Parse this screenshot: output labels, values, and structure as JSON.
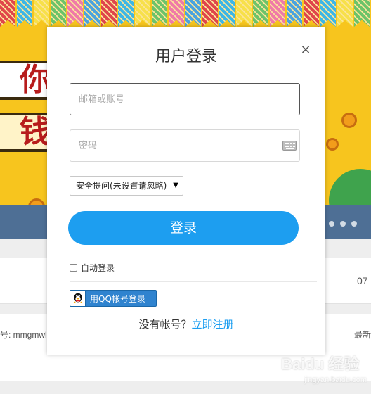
{
  "dialog": {
    "title": "用户登录",
    "close_label": "×",
    "email_placeholder": "邮箱或账号",
    "password_placeholder": "密码",
    "security_question": "安全提问(未设置请忽略)",
    "login_label": "登录",
    "auto_login_label": "自动登录",
    "qq_login_label": "用QQ帐号登录",
    "no_account_text": "没有帐号？",
    "register_label": "立即注册"
  },
  "background": {
    "banner_text_1": "你在",
    "banner_text_2": "钱",
    "row1_right": "07",
    "row2_left": "号: mmgmwl",
    "row2_right": "最新"
  },
  "watermark": {
    "text": "Baidu 经验",
    "sub": "jingyan.baidu.com"
  },
  "colors": {
    "accent": "#1d9ef0",
    "banner": "#f7c51e",
    "qq_button": "#2f83cf"
  },
  "icons": [
    "close-icon",
    "keyboard-icon",
    "caret-down-icon",
    "qq-penguin-icon"
  ]
}
